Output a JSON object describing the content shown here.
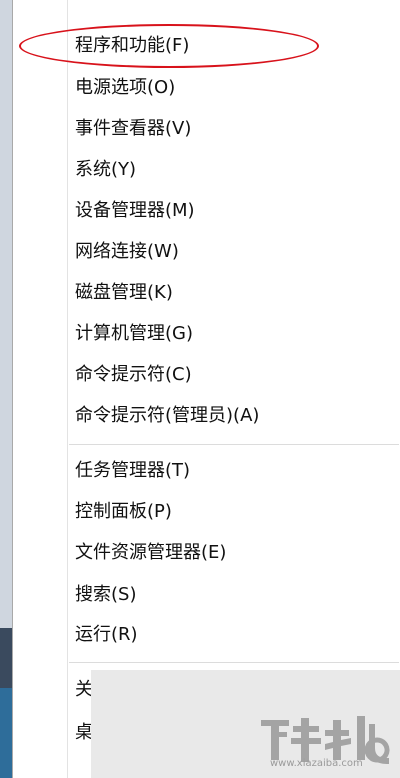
{
  "menu": {
    "items": [
      {
        "label": "程序和功能(F)"
      },
      {
        "label": "电源选项(O)"
      },
      {
        "label": "事件查看器(V)"
      },
      {
        "label": "系统(Y)"
      },
      {
        "label": "设备管理器(M)"
      },
      {
        "label": "网络连接(W)"
      },
      {
        "label": "磁盘管理(K)"
      },
      {
        "label": "计算机管理(G)"
      },
      {
        "label": "命令提示符(C)"
      },
      {
        "label": "命令提示符(管理员)(A)"
      },
      {
        "label": "任务管理器(T)"
      },
      {
        "label": "控制面板(P)"
      },
      {
        "label": "文件资源管理器(E)"
      },
      {
        "label": "搜索(S)"
      },
      {
        "label": "运行(R)"
      },
      {
        "label": "关"
      },
      {
        "label": "桌"
      }
    ]
  },
  "annotation": {
    "color": "#d8121b"
  },
  "watermark": {
    "text": "www.xiazaiba.com"
  }
}
